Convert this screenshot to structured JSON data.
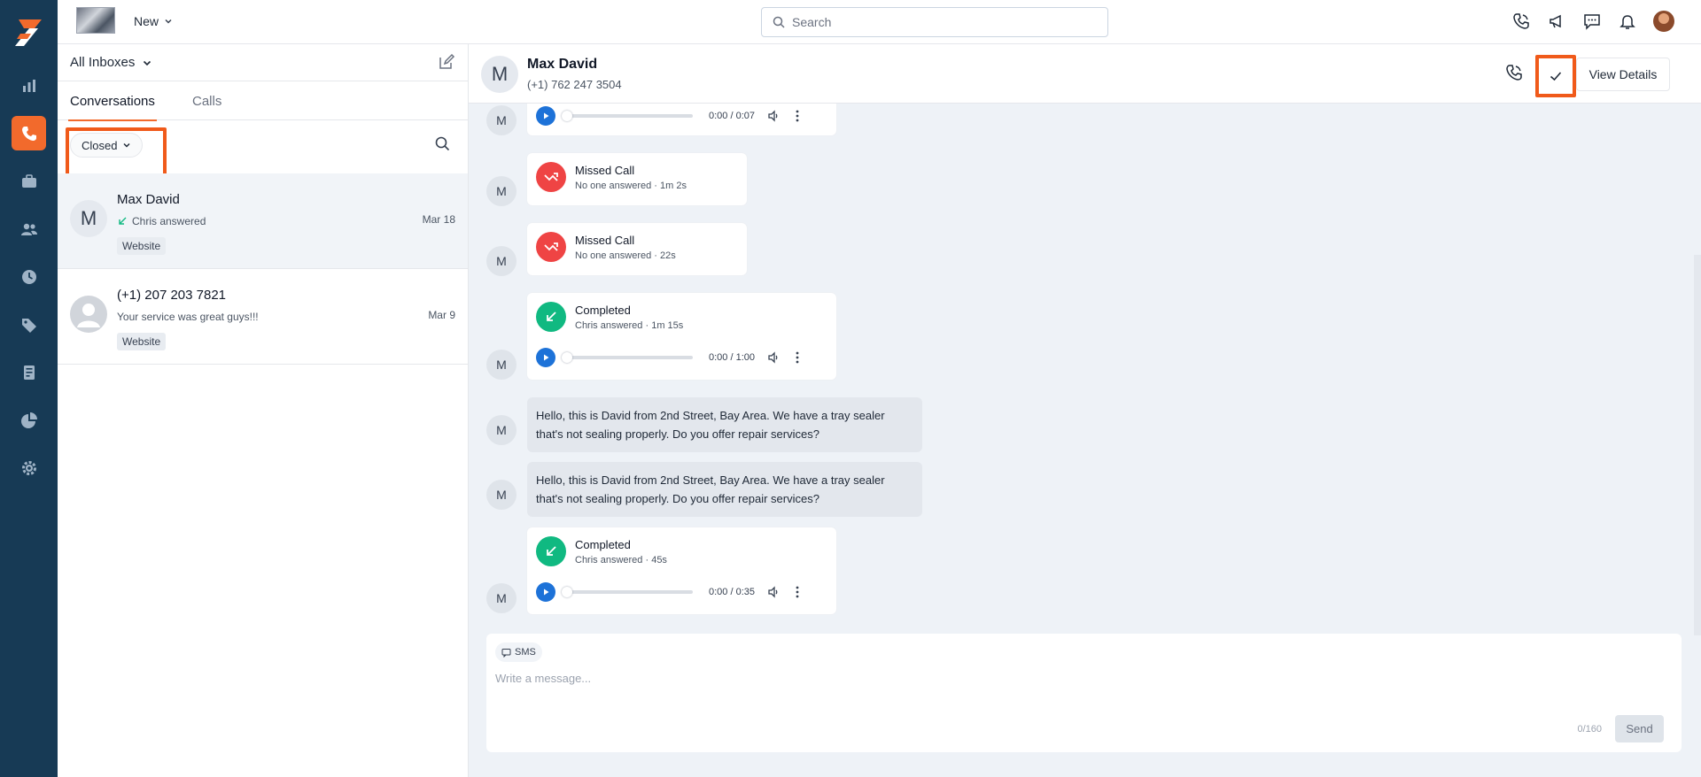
{
  "topbar": {
    "new_label": "New",
    "search_placeholder": "Search"
  },
  "rail": {
    "items": [
      "reports-icon",
      "calls-icon",
      "briefcase-icon",
      "contacts-icon",
      "history-icon",
      "tags-icon",
      "billing-icon",
      "analytics-icon",
      "settings-icon"
    ],
    "accent": "#f26a2c",
    "background": "#173a55"
  },
  "list": {
    "inbox_title": "All Inboxes",
    "tabs": [
      "Conversations",
      "Calls"
    ],
    "filter_label": "Closed",
    "conversations": [
      {
        "avatar": "M",
        "name": "Max David",
        "snippet": "Chris answered",
        "date": "Mar 18",
        "tag": "Website"
      },
      {
        "avatar": "",
        "name": "(+1) 207 203 7821",
        "snippet": "Your service was great guys!!!",
        "date": "Mar 9",
        "tag": "Website"
      }
    ]
  },
  "chat": {
    "avatar": "M",
    "name": "Max David",
    "phone": "(+1) 762 247 3504",
    "view_details": "View Details",
    "messages": [
      {
        "avatar": "M",
        "time": "0:00 / 0:07"
      },
      {
        "avatar": "M",
        "title": "Missed Call",
        "meta": "No one answered · 1m 2s"
      },
      {
        "avatar": "M",
        "title": "Missed Call",
        "meta": "No one answered · 22s"
      },
      {
        "avatar": "M",
        "title": "Completed",
        "meta": "Chris answered · 1m 15s",
        "time": "0:00 / 1:00"
      },
      {
        "avatar": "M",
        "text": "Hello, this is David from 2nd Street, Bay Area. We have a tray sealer that's not sealing properly. Do you offer repair services?"
      },
      {
        "avatar": "M",
        "text": "Hello, this is David from 2nd Street, Bay Area. We have a tray sealer that's not sealing properly. Do you offer repair services?"
      },
      {
        "avatar": "M",
        "title": "Completed",
        "meta": "Chris answered · 45s",
        "time": "0:00 / 0:35"
      }
    ],
    "composer": {
      "channel": "SMS",
      "placeholder": "Write a message...",
      "counter": "0/160",
      "send": "Send"
    }
  }
}
